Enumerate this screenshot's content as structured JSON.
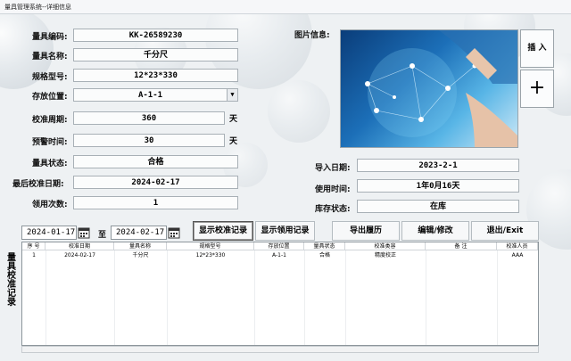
{
  "window": {
    "title": "量具管理系统--详细信息"
  },
  "form": {
    "code_label": "量具编码:",
    "code_value": "KK-26589230",
    "name_label": "量具名称:",
    "name_value": "千分尺",
    "spec_label": "规格型号:",
    "spec_value": "12*23*330",
    "location_label": "存放位置:",
    "location_value": "A-1-1",
    "cycle_label": "校准周期:",
    "cycle_value": "360",
    "cycle_unit": "天",
    "warn_label": "预警时间:",
    "warn_value": "30",
    "warn_unit": "天",
    "status_label": "量具状态:",
    "status_value": "合格",
    "lastcal_label": "最后校准日期:",
    "lastcal_value": "2024-02-17",
    "usecount_label": "领用次数:",
    "usecount_value": "1"
  },
  "photo": {
    "label": "图片信息:",
    "insert_label": "插 入",
    "add_symbol": "+"
  },
  "info": {
    "import_label": "导入日期:",
    "import_value": "2023-2-1",
    "usetime_label": "使用时间:",
    "usetime_value": "1年0月16天",
    "stock_label": "库存状态:",
    "stock_value": "在库"
  },
  "filter": {
    "date_from": "2024-01-17",
    "to_label": "至",
    "date_to": "2024-02-17"
  },
  "buttons": {
    "show_cal": "显示校准记录",
    "show_use": "显示领用记录",
    "export": "导出履历",
    "edit": "编辑/修改",
    "exit": "退出/Exit"
  },
  "grid": {
    "side_label": "量具校准记录",
    "columns": [
      "序 号",
      "校准日期",
      "量具名称",
      "规格型号",
      "存放位置",
      "量具状态",
      "校准类容",
      "备 注",
      "校准人员"
    ],
    "rows": [
      [
        "1",
        "2024-02-17",
        "千分尺",
        "12*23*330",
        "A-1-1",
        "合格",
        "精度校正",
        "",
        "AAA"
      ]
    ]
  }
}
